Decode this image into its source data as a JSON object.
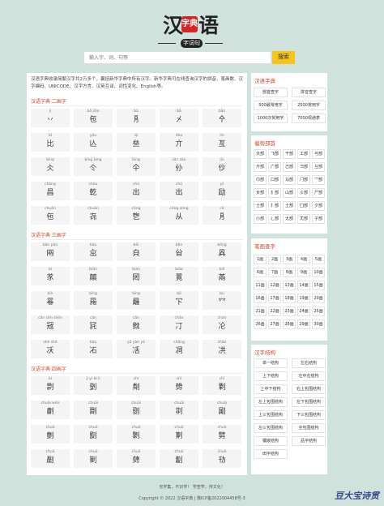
{
  "logo": {
    "c1": "汉",
    "seal": "字典",
    "c3": "语",
    "sub": "字词句"
  },
  "search": {
    "placeholder": "输入字、词、句等",
    "button": "搜索"
  },
  "intro": "汉语字典收录简繁汉字共2万多个，囊括新华字典中所有汉字。新华字典可在线查询汉字的拼音、笔画数、汉字编码、UNICODE、汉字方言、汉英互译、词性变化、English等。",
  "sections": [
    {
      "title": "汉语字典 二画字",
      "cells": [
        [
          "jí",
          "丷"
        ],
        [
          "bā jiǎo",
          "㐌"
        ],
        [
          "bā",
          "㐆"
        ],
        [
          "bā",
          "㐅"
        ],
        [
          "bāo",
          "㐃"
        ],
        [
          "bǐ",
          "比"
        ],
        [
          "yōu",
          "亾"
        ],
        [
          "qī",
          "亝"
        ],
        [
          "dòu",
          "亣"
        ],
        [
          "lìn",
          "亙"
        ],
        [
          "bīng",
          "仌"
        ],
        [
          "bīng bìng",
          "仒"
        ],
        [
          "bīng",
          "仐"
        ],
        [
          "sǎn zǎn",
          "仦"
        ],
        [
          "jǐn",
          "仯"
        ],
        [
          "chǎng",
          "昌"
        ],
        [
          "chòu",
          "亁"
        ],
        [
          "chū",
          "出"
        ],
        [
          "chū",
          "出"
        ],
        [
          "pī",
          "劶"
        ],
        [
          "chuān",
          "㐌"
        ],
        [
          "chuán",
          "㐂"
        ],
        [
          "cōng",
          "㐝"
        ],
        [
          "cóng zòng",
          "从"
        ],
        [
          "cè",
          "㐆"
        ]
      ]
    },
    {
      "title": "汉语字典 三画字",
      "cells": [
        [
          "bǎn pàn",
          "㒳"
        ],
        [
          "bāo",
          "㒴"
        ],
        [
          "bēi",
          "㒵"
        ],
        [
          "bèn",
          "㒶"
        ],
        [
          "bēng",
          "㒷"
        ],
        [
          "bì",
          "㒸"
        ],
        [
          "biān",
          "㒹"
        ],
        [
          "biàn",
          "㒺"
        ],
        [
          "biǎo",
          "㒻"
        ],
        [
          "biē",
          "㒼"
        ],
        [
          "bīn",
          "㒽"
        ],
        [
          "bīng",
          "㒾"
        ],
        [
          "bīng",
          "㒿"
        ],
        [
          "bō",
          "㓀"
        ],
        [
          "bù",
          "㓁"
        ],
        [
          "cān cēn shēn",
          "㓂"
        ],
        [
          "cān",
          "㓃"
        ],
        [
          "cān",
          "㓄"
        ],
        [
          "chān",
          "㓅"
        ],
        [
          "chán",
          "㓆"
        ],
        [
          "shě shé",
          "㓇"
        ],
        [
          "bāo",
          "㓈"
        ],
        [
          "yā yàn yè",
          "㓉"
        ],
        [
          "chǎng",
          "㓊"
        ],
        [
          "chāo",
          "㓋"
        ]
      ]
    },
    {
      "title": "汉语字典 四画字",
      "cells": [
        [
          "bì",
          "㔀"
        ],
        [
          "jí yì bì lì",
          "㔁"
        ],
        [
          "chí",
          "㔂"
        ],
        [
          "chī",
          "㔃"
        ],
        [
          "chī",
          "㔄"
        ],
        [
          "chuāi wěn",
          "㔅"
        ],
        [
          "chuāi",
          "㔆"
        ],
        [
          "chuāi",
          "㔇"
        ],
        [
          "chuāi",
          "㔈"
        ],
        [
          "chuāi",
          "㔉"
        ],
        [
          "chuò",
          "㔊"
        ],
        [
          "chuò",
          "㔋"
        ],
        [
          "chuò",
          "㔌"
        ],
        [
          "chuò",
          "㔍"
        ],
        [
          "chuò",
          "㔎"
        ],
        [
          "chuò",
          "㔏"
        ],
        [
          "chuò",
          "㔐"
        ],
        [
          "chuò",
          "㔑"
        ],
        [
          "chuò",
          "㔒"
        ],
        [
          "chuò",
          "㔓"
        ]
      ]
    }
  ],
  "side_dict": {
    "title": "汉语字典",
    "buttons": [
      "部首查字",
      "拼音查字",
      "500最常用字",
      "2500常用字",
      "1000次常用字",
      "7000现通表"
    ]
  },
  "side_radicals": {
    "title": "偏旁部首",
    "buttons": [
      "大部",
      "飞部",
      "干部",
      "工部",
      "弓部",
      "廾部",
      "广部",
      "己部",
      "彐部",
      "彑部",
      "巾部",
      "口部",
      "马部",
      "门部",
      "宀部",
      "女部",
      "犭部",
      "山部",
      "彡部",
      "尸部",
      "士部",
      "扌部",
      "土部",
      "囗部",
      "夕部",
      "小部",
      "辶部",
      "尢部",
      "尤部",
      "子部"
    ]
  },
  "side_strokes": {
    "title": "笔画查字",
    "buttons": [
      "1画",
      "2画",
      "3画",
      "4画",
      "5画",
      "6画",
      "7画",
      "8画",
      "9画",
      "10画",
      "11画",
      "12画",
      "13画",
      "14画",
      "15画",
      "16画",
      "17画",
      "18画",
      "19画",
      "20画",
      "21画",
      "22画",
      "23画",
      "24画",
      "25画",
      "26画",
      "27画",
      "28画",
      "29画",
      "30画"
    ]
  },
  "side_struct": {
    "title": "汉字结构",
    "buttons": [
      "单一结构",
      "左右结构",
      "上下结构",
      "左中右结构",
      "上中下结构",
      "右上包围结构",
      "左上包围结构",
      "左下包围结构",
      "上三包围结构",
      "下三包围结构",
      "左三包围结构",
      "全包围结构",
      "镶嵌结构",
      "品字结构",
      "田字结构"
    ]
  },
  "footer": {
    "line1": "无学集，不识学！ 学查学，传文化！",
    "line2": "Copyright © 2022 汉语字典 | 豫ICP备2022004458号-3"
  },
  "watermark": "豆大宝诗贯"
}
